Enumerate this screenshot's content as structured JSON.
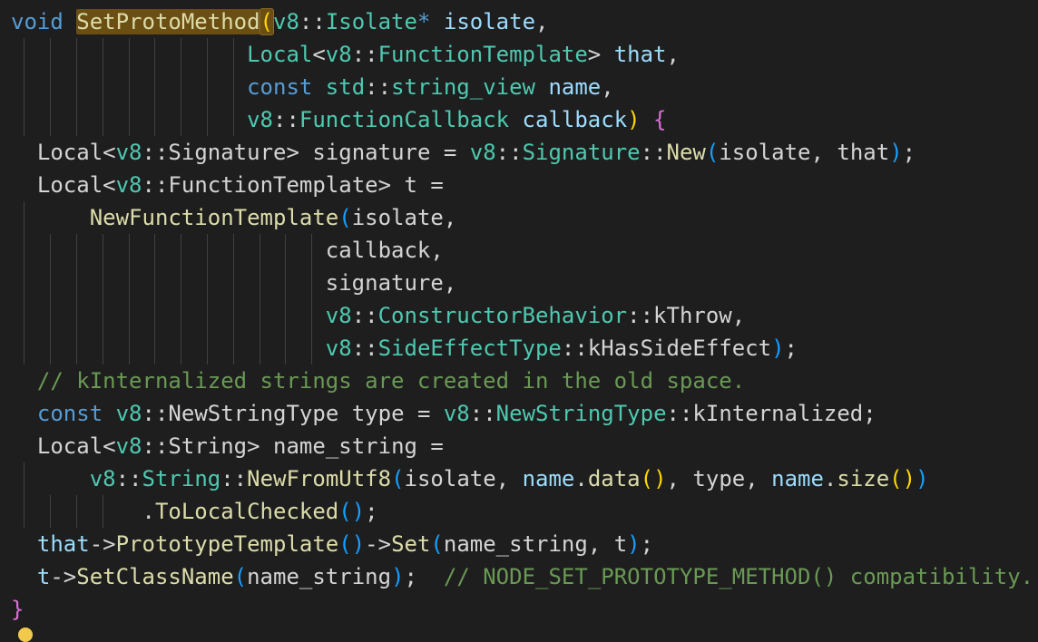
{
  "colors": {
    "keyword": "#569cd6",
    "type": "#4ec9b0",
    "function": "#dcdcaa",
    "variable": "#9cdcfe",
    "text": "#d4d4d4",
    "comment": "#6a9955",
    "bracket_yellow": "#ffd700",
    "bracket_purple": "#da70d6",
    "bracket_blue": "#179fff",
    "guide": "#404040",
    "lightbulb": "#f2c94c"
  },
  "icons": {
    "lightbulb": "lightbulb-icon"
  },
  "lines": [
    {
      "guides": [],
      "tokens": [
        {
          "text": "void ",
          "cls": "keyword"
        },
        {
          "text": "SetProtoMethod",
          "cls": "function",
          "hl": "box"
        },
        {
          "text": "(",
          "cls": "bracket_yellow",
          "hl": "paren"
        },
        {
          "text": "v8",
          "cls": "type"
        },
        {
          "text": "::",
          "cls": "text"
        },
        {
          "text": "Isolate",
          "cls": "type"
        },
        {
          "text": "* ",
          "cls": "keyword"
        },
        {
          "text": "isolate",
          "cls": "variable"
        },
        {
          "text": ",",
          "cls": "text"
        }
      ]
    },
    {
      "guides": [
        1,
        3,
        5,
        7,
        9,
        11,
        13,
        15,
        17
      ],
      "tokens": [
        {
          "text": "                  "
        },
        {
          "text": "Local",
          "cls": "type"
        },
        {
          "text": "<",
          "cls": "text"
        },
        {
          "text": "v8",
          "cls": "type"
        },
        {
          "text": "::",
          "cls": "text"
        },
        {
          "text": "FunctionTemplate",
          "cls": "type"
        },
        {
          "text": "> ",
          "cls": "text"
        },
        {
          "text": "that",
          "cls": "variable"
        },
        {
          "text": ",",
          "cls": "text"
        }
      ]
    },
    {
      "guides": [
        1,
        3,
        5,
        7,
        9,
        11,
        13,
        15,
        17
      ],
      "tokens": [
        {
          "text": "                  "
        },
        {
          "text": "const ",
          "cls": "keyword"
        },
        {
          "text": "std",
          "cls": "type"
        },
        {
          "text": "::",
          "cls": "text"
        },
        {
          "text": "string_view ",
          "cls": "type"
        },
        {
          "text": "name",
          "cls": "variable"
        },
        {
          "text": ",",
          "cls": "text"
        }
      ]
    },
    {
      "guides": [
        1,
        3,
        5,
        7,
        9,
        11,
        13,
        15,
        17
      ],
      "tokens": [
        {
          "text": "                  "
        },
        {
          "text": "v8",
          "cls": "type"
        },
        {
          "text": "::",
          "cls": "text"
        },
        {
          "text": "FunctionCallback ",
          "cls": "type"
        },
        {
          "text": "callback",
          "cls": "variable"
        },
        {
          "text": ")",
          "cls": "bracket_yellow"
        },
        {
          "text": " ",
          "cls": "text"
        },
        {
          "text": "{",
          "cls": "bracket_purple"
        }
      ]
    },
    {
      "guides": [],
      "tokens": [
        {
          "text": "  "
        },
        {
          "text": "Local",
          "cls": "text"
        },
        {
          "text": "<",
          "cls": "text"
        },
        {
          "text": "v8",
          "cls": "type"
        },
        {
          "text": "::",
          "cls": "text"
        },
        {
          "text": "Signature",
          "cls": "text"
        },
        {
          "text": "> signature = ",
          "cls": "text"
        },
        {
          "text": "v8",
          "cls": "type"
        },
        {
          "text": "::",
          "cls": "text"
        },
        {
          "text": "Signature",
          "cls": "type"
        },
        {
          "text": "::",
          "cls": "text"
        },
        {
          "text": "New",
          "cls": "function"
        },
        {
          "text": "(",
          "cls": "bracket_blue"
        },
        {
          "text": "isolate, that",
          "cls": "text"
        },
        {
          "text": ")",
          "cls": "bracket_blue"
        },
        {
          "text": ";",
          "cls": "text"
        }
      ]
    },
    {
      "guides": [],
      "tokens": [
        {
          "text": "  "
        },
        {
          "text": "Local",
          "cls": "text"
        },
        {
          "text": "<",
          "cls": "text"
        },
        {
          "text": "v8",
          "cls": "type"
        },
        {
          "text": "::",
          "cls": "text"
        },
        {
          "text": "FunctionTemplate",
          "cls": "text"
        },
        {
          "text": "> t =",
          "cls": "text"
        }
      ]
    },
    {
      "guides": [
        1
      ],
      "tokens": [
        {
          "text": "      "
        },
        {
          "text": "NewFunctionTemplate",
          "cls": "function"
        },
        {
          "text": "(",
          "cls": "bracket_blue"
        },
        {
          "text": "isolate,",
          "cls": "text"
        }
      ]
    },
    {
      "guides": [
        1,
        3,
        5,
        7,
        9,
        11,
        13,
        15,
        17,
        19,
        21,
        23
      ],
      "tokens": [
        {
          "text": "                        "
        },
        {
          "text": "callback,",
          "cls": "text"
        }
      ]
    },
    {
      "guides": [
        1,
        3,
        5,
        7,
        9,
        11,
        13,
        15,
        17,
        19,
        21,
        23
      ],
      "tokens": [
        {
          "text": "                        "
        },
        {
          "text": "signature,",
          "cls": "text"
        }
      ]
    },
    {
      "guides": [
        1,
        3,
        5,
        7,
        9,
        11,
        13,
        15,
        17,
        19,
        21,
        23
      ],
      "tokens": [
        {
          "text": "                        "
        },
        {
          "text": "v8",
          "cls": "type"
        },
        {
          "text": "::",
          "cls": "text"
        },
        {
          "text": "ConstructorBehavior",
          "cls": "type"
        },
        {
          "text": "::kThrow,",
          "cls": "text"
        }
      ]
    },
    {
      "guides": [
        1,
        3,
        5,
        7,
        9,
        11,
        13,
        15,
        17,
        19,
        21,
        23
      ],
      "tokens": [
        {
          "text": "                        "
        },
        {
          "text": "v8",
          "cls": "type"
        },
        {
          "text": "::",
          "cls": "text"
        },
        {
          "text": "SideEffectType",
          "cls": "type"
        },
        {
          "text": "::kHasSideEffect",
          "cls": "text"
        },
        {
          "text": ")",
          "cls": "bracket_blue"
        },
        {
          "text": ";",
          "cls": "text"
        }
      ]
    },
    {
      "guides": [],
      "tokens": [
        {
          "text": "  "
        },
        {
          "text": "// kInternalized strings are created in the old space.",
          "cls": "comment"
        }
      ]
    },
    {
      "guides": [],
      "tokens": [
        {
          "text": "  "
        },
        {
          "text": "const ",
          "cls": "keyword"
        },
        {
          "text": "v8",
          "cls": "type"
        },
        {
          "text": "::",
          "cls": "text"
        },
        {
          "text": "NewStringType",
          "cls": "text"
        },
        {
          "text": " type = ",
          "cls": "text"
        },
        {
          "text": "v8",
          "cls": "type"
        },
        {
          "text": "::",
          "cls": "text"
        },
        {
          "text": "NewStringType",
          "cls": "type"
        },
        {
          "text": "::kInternalized;",
          "cls": "text"
        }
      ]
    },
    {
      "guides": [],
      "tokens": [
        {
          "text": "  "
        },
        {
          "text": "Local",
          "cls": "text"
        },
        {
          "text": "<",
          "cls": "text"
        },
        {
          "text": "v8",
          "cls": "type"
        },
        {
          "text": "::",
          "cls": "text"
        },
        {
          "text": "String",
          "cls": "text"
        },
        {
          "text": "> name_string =",
          "cls": "text"
        }
      ]
    },
    {
      "guides": [
        1
      ],
      "tokens": [
        {
          "text": "      "
        },
        {
          "text": "v8",
          "cls": "type"
        },
        {
          "text": "::",
          "cls": "text"
        },
        {
          "text": "String",
          "cls": "type"
        },
        {
          "text": "::",
          "cls": "text"
        },
        {
          "text": "NewFromUtf8",
          "cls": "function"
        },
        {
          "text": "(",
          "cls": "bracket_blue"
        },
        {
          "text": "isolate, ",
          "cls": "text"
        },
        {
          "text": "name",
          "cls": "variable"
        },
        {
          "text": ".",
          "cls": "text"
        },
        {
          "text": "data",
          "cls": "function"
        },
        {
          "text": "()",
          "cls": "bracket_yellow"
        },
        {
          "text": ", type, ",
          "cls": "text"
        },
        {
          "text": "name",
          "cls": "variable"
        },
        {
          "text": ".",
          "cls": "text"
        },
        {
          "text": "size",
          "cls": "function"
        },
        {
          "text": "()",
          "cls": "bracket_yellow"
        },
        {
          "text": ")",
          "cls": "bracket_blue"
        }
      ]
    },
    {
      "guides": [
        1,
        3,
        5,
        7
      ],
      "tokens": [
        {
          "text": "          "
        },
        {
          "text": ".",
          "cls": "text"
        },
        {
          "text": "ToLocalChecked",
          "cls": "function"
        },
        {
          "text": "()",
          "cls": "bracket_blue"
        },
        {
          "text": ";",
          "cls": "text"
        }
      ]
    },
    {
      "guides": [],
      "tokens": [
        {
          "text": "  "
        },
        {
          "text": "that",
          "cls": "variable"
        },
        {
          "text": "->",
          "cls": "text"
        },
        {
          "text": "PrototypeTemplate",
          "cls": "function"
        },
        {
          "text": "()",
          "cls": "bracket_blue"
        },
        {
          "text": "->",
          "cls": "text"
        },
        {
          "text": "Set",
          "cls": "function"
        },
        {
          "text": "(",
          "cls": "bracket_blue"
        },
        {
          "text": "name_string, t",
          "cls": "text"
        },
        {
          "text": ")",
          "cls": "bracket_blue"
        },
        {
          "text": ";",
          "cls": "text"
        }
      ]
    },
    {
      "guides": [],
      "tokens": [
        {
          "text": "  "
        },
        {
          "text": "t",
          "cls": "variable"
        },
        {
          "text": "->",
          "cls": "text"
        },
        {
          "text": "SetClassName",
          "cls": "function"
        },
        {
          "text": "(",
          "cls": "bracket_blue"
        },
        {
          "text": "name_string",
          "cls": "text"
        },
        {
          "text": ")",
          "cls": "bracket_blue"
        },
        {
          "text": ";  ",
          "cls": "text"
        },
        {
          "text": "// NODE_SET_PROTOTYPE_METHOD() compatibility.",
          "cls": "comment"
        }
      ]
    },
    {
      "guides": [],
      "tokens": [
        {
          "text": "}",
          "cls": "bracket_purple"
        }
      ]
    }
  ]
}
